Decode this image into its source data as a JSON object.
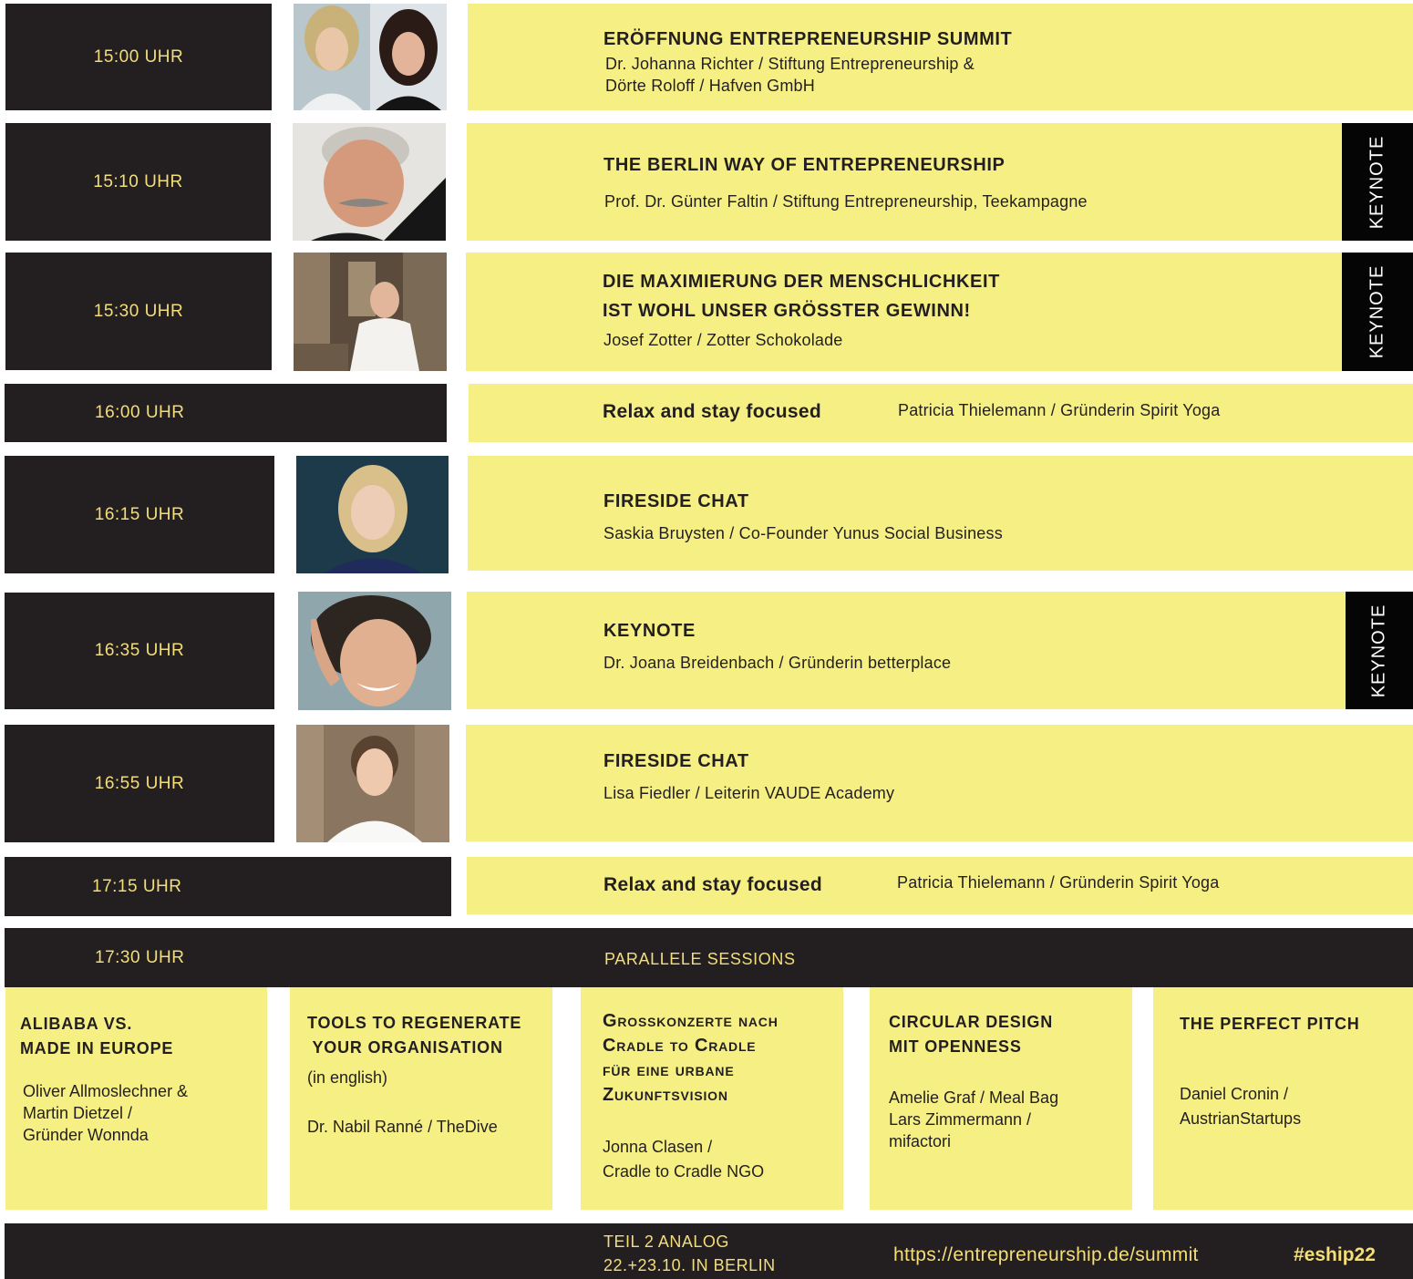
{
  "colors": {
    "dark": "#231f20",
    "yellow": "#f6f084",
    "gold_text": "#f3de7a",
    "keynote_tab": "#050505"
  },
  "schedule": [
    {
      "time": "15:00 UHR",
      "title_lines": [
        "ERÖFFNUNG ENTREPRENEURSHIP SUMMIT"
      ],
      "speaker_lines": [
        "Dr. Johanna Richter / Stiftung Entrepreneurship &",
        "Dörte Roloff / Hafven GmbH"
      ]
    },
    {
      "time": "15:10 UHR",
      "title_lines": [
        "THE BERLIN WAY OF ENTREPRENEURSHIP"
      ],
      "speaker_lines": [
        "Prof. Dr. Günter Faltin / Stiftung Entrepreneurship, Teekampagne"
      ],
      "tag": "KEYNOTE"
    },
    {
      "time": "15:30 UHR",
      "title_lines": [
        "DIE MAXIMIERUNG DER MENSCHLICHKEIT",
        "IST WOHL UNSER GRÖSSTER GEWINN!"
      ],
      "speaker_lines": [
        "Josef Zotter / Zotter Schokolade"
      ],
      "tag": "KEYNOTE"
    },
    {
      "time": "16:00 UHR",
      "title": "Relax and stay focused",
      "speaker": "Patricia Thielemann / Gründerin Spirit Yoga"
    },
    {
      "time": "16:15 UHR",
      "title_lines": [
        "FIRESIDE CHAT"
      ],
      "speaker_lines": [
        "Saskia Bruysten / Co-Founder Yunus Social Business"
      ]
    },
    {
      "time": "16:35 UHR",
      "title_lines": [
        "KEYNOTE"
      ],
      "speaker_lines": [
        "Dr. Joana Breidenbach / Gründerin betterplace"
      ],
      "tag": "KEYNOTE"
    },
    {
      "time": "16:55 UHR",
      "title_lines": [
        "FIRESIDE CHAT"
      ],
      "speaker_lines": [
        "Lisa Fiedler / Leiterin VAUDE Academy"
      ]
    },
    {
      "time": "17:15 UHR",
      "title": "Relax and stay focused",
      "speaker": "Patricia Thielemann / Gründerin Spirit Yoga"
    }
  ],
  "parallel": {
    "time": "17:30 UHR",
    "label": "PARALLELE SESSIONS",
    "sessions": [
      {
        "title": "ALIBABA VS.\nMADE IN EUROPE",
        "speaker": "Oliver Allmoslechner &\nMartin Dietzel /\nGründer Wonnda"
      },
      {
        "title": "TOOLS TO REGENERATE\n YOUR ORGANISATION",
        "note": "(in english)",
        "speaker": "Dr. Nabil Ranné / TheDive"
      },
      {
        "title": "Grosskonzerte nach\nCradle to Cradle\nfür eine urbane\nZukunftsvision",
        "speaker": "Jonna Clasen /\nCradle to Cradle NGO"
      },
      {
        "title": "CIRCULAR DESIGN\nMIT OPENNESS",
        "speaker": "Amelie Graf / Meal Bag\nLars Zimmermann /\nmifactori"
      },
      {
        "title": "THE PERFECT PITCH",
        "speaker": "Daniel Cronin /\nAustrianStartups"
      }
    ]
  },
  "footer": {
    "line1": "TEIL 2 ANALOG",
    "line2": "22.+23.10. IN BERLIN",
    "url": "https://entrepreneurship.de/summit",
    "hashtag": "#eship22"
  }
}
